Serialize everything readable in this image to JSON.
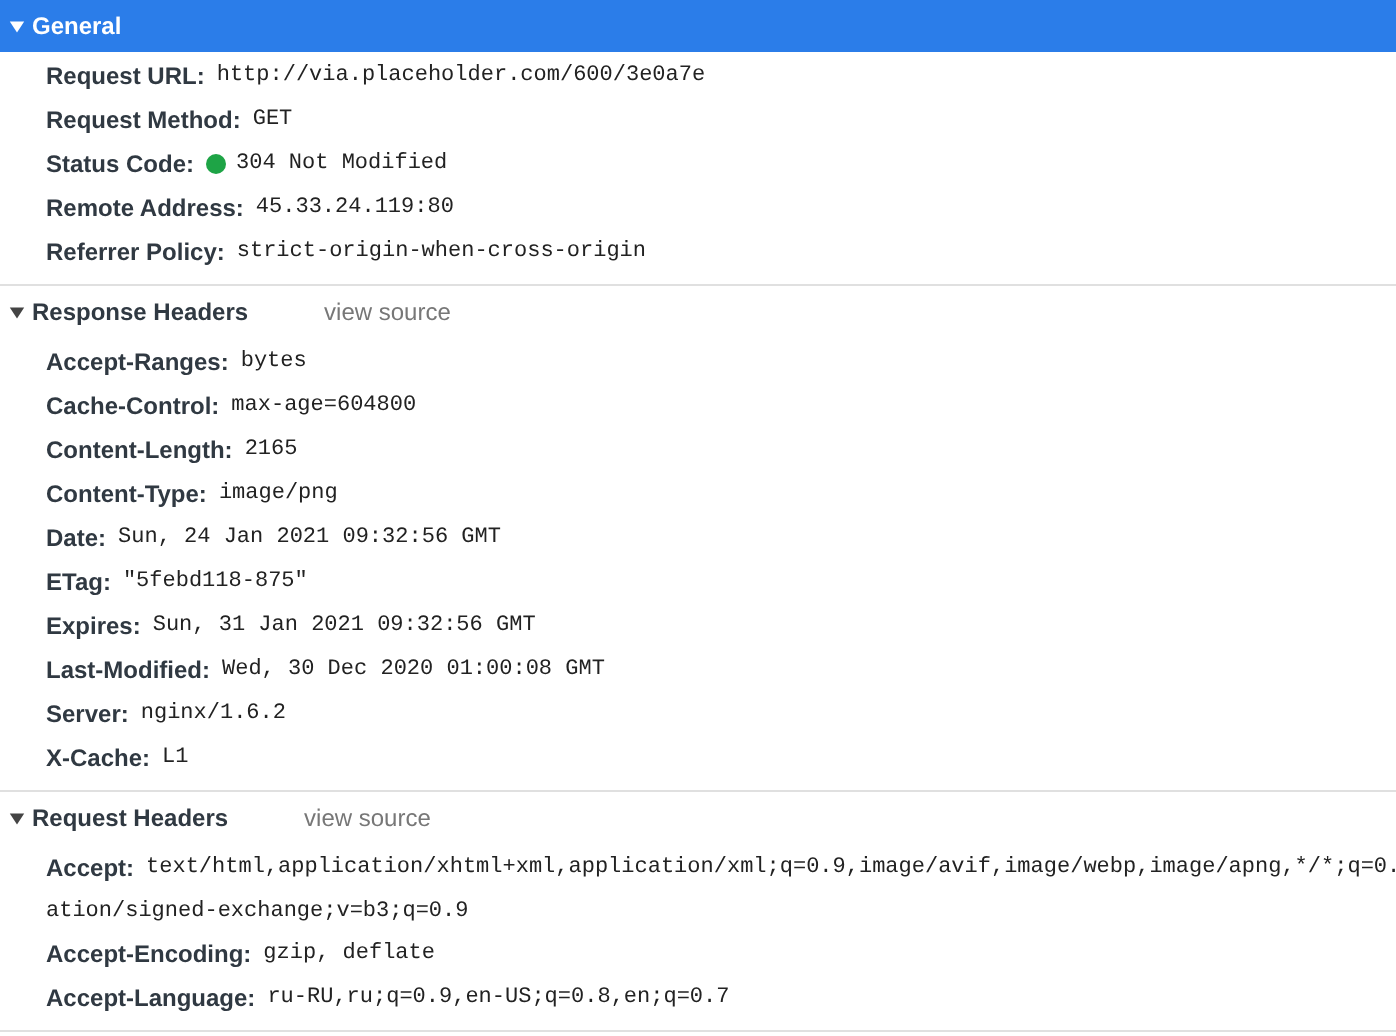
{
  "sections": [
    {
      "title": "General",
      "selected": true,
      "expanded": true,
      "rows": [
        {
          "name": "Request URL:",
          "value": [
            "http://via.placeholder.com/600/3e0a7e"
          ]
        },
        {
          "name": "Request Method:",
          "value": [
            "GET"
          ]
        },
        {
          "name": "Status Code:",
          "value": [
            "304 Not Modified"
          ],
          "color": "#1ea446"
        },
        {
          "name": "Remote Address:",
          "value": [
            "45.33.24.119:80"
          ]
        },
        {
          "name": "Referrer Policy:",
          "value": [
            "strict-origin-when-cross-origin"
          ]
        }
      ]
    },
    {
      "title": "Response Headers",
      "selected": false,
      "expanded": true,
      "link": "view source",
      "rows": [
        {
          "name": "Accept-Ranges:",
          "value": [
            "bytes"
          ]
        },
        {
          "name": "Cache-Control:",
          "value": [
            "max-age=604800"
          ]
        },
        {
          "name": "Content-Length:",
          "value": [
            "2165"
          ]
        },
        {
          "name": "Content-Type:",
          "value": [
            "image/png"
          ]
        },
        {
          "name": "Date:",
          "value": [
            "Sun, 24 Jan 2021 09:32:56 GMT"
          ]
        },
        {
          "name": "ETag:",
          "value": [
            "\"5febd118-875\""
          ]
        },
        {
          "name": "Expires:",
          "value": [
            "Sun, 31 Jan 2021 09:32:56 GMT"
          ]
        },
        {
          "name": "Last-Modified:",
          "value": [
            "Wed, 30 Dec 2020 01:00:08 GMT"
          ]
        },
        {
          "name": "Server:",
          "value": [
            "nginx/1.6.2"
          ]
        },
        {
          "name": "X-Cache:",
          "value": [
            "L1"
          ]
        }
      ]
    },
    {
      "title": "Request Headers",
      "selected": false,
      "expanded": true,
      "link": "view source",
      "rows": [
        {
          "name": "Accept:",
          "value": [
            "text/html,application/xhtml+xml,application/xml;q=0.9,image/avif,image/webp,image/apng,*/*;q=0.",
            "ation/signed-exchange;v=b3;q=0.9"
          ]
        },
        {
          "name": "Accept-Encoding:",
          "value": [
            "gzip, deflate"
          ]
        },
        {
          "name": "Accept-Language:",
          "value": [
            "ru-RU,ru;q=0.9,en-US;q=0.8,en;q=0.7"
          ]
        }
      ]
    }
  ]
}
